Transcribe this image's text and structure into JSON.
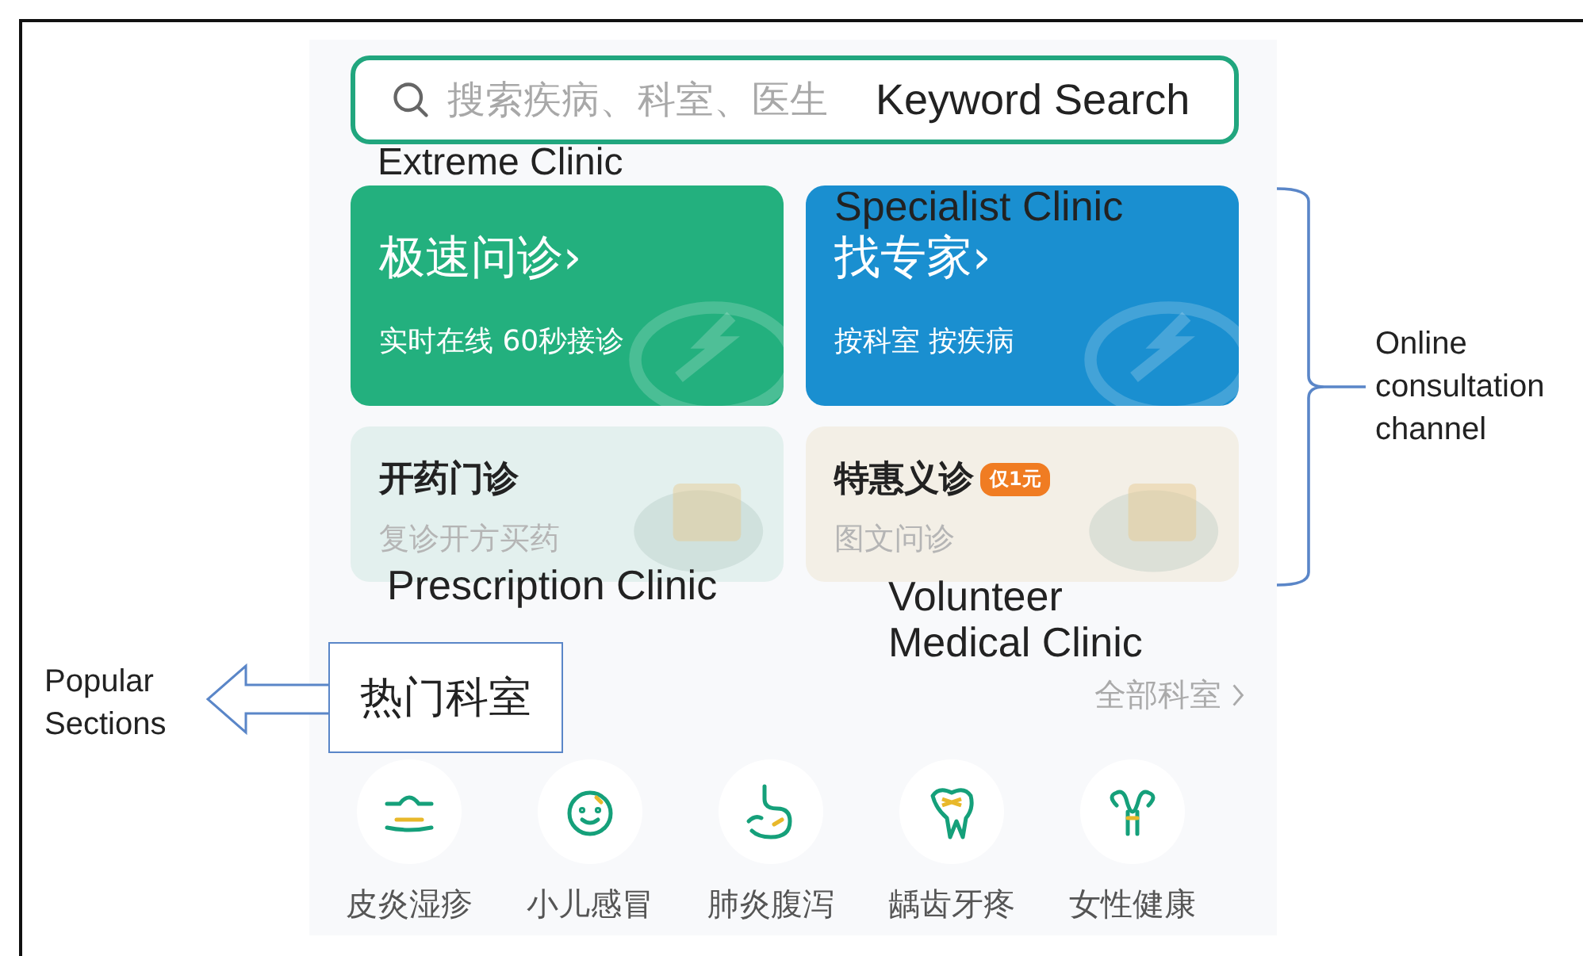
{
  "search": {
    "placeholder": "搜索疾病、科室、医生",
    "annotation": "Keyword Search"
  },
  "channels": [
    {
      "kind": "primary",
      "title": "极速问诊›",
      "subtitle": "实时在线 60秒接诊",
      "annotation": "Extreme Clinic",
      "color": "#23b07e"
    },
    {
      "kind": "primary",
      "title": "找专家›",
      "subtitle": "按科室 按疾病",
      "annotation": "Specialist Clinic",
      "color": "#1a8fd0"
    },
    {
      "kind": "secondary",
      "title": "开药门诊",
      "subtitle": "复诊开方买药",
      "annotation": "Prescription Clinic",
      "color": "#e3f0ee"
    },
    {
      "kind": "secondary",
      "title": "特惠义诊",
      "badge": "仅1元",
      "subtitle": "图文问诊",
      "annotation": "Volunteer Medical Clinic",
      "color": "#f3efe6"
    }
  ],
  "channel_label": "Online consultation channel",
  "section": {
    "title": "热门科室",
    "annotation": "Popular Sections",
    "link": "全部科室"
  },
  "departments": [
    {
      "name": "皮炎湿疹",
      "kind": "skin"
    },
    {
      "name": "小儿感冒",
      "kind": "baby"
    },
    {
      "name": "肺炎腹泻",
      "kind": "stomach"
    },
    {
      "name": "龋齿牙疼",
      "kind": "tooth"
    },
    {
      "name": "女性健康",
      "kind": "uterus"
    }
  ]
}
